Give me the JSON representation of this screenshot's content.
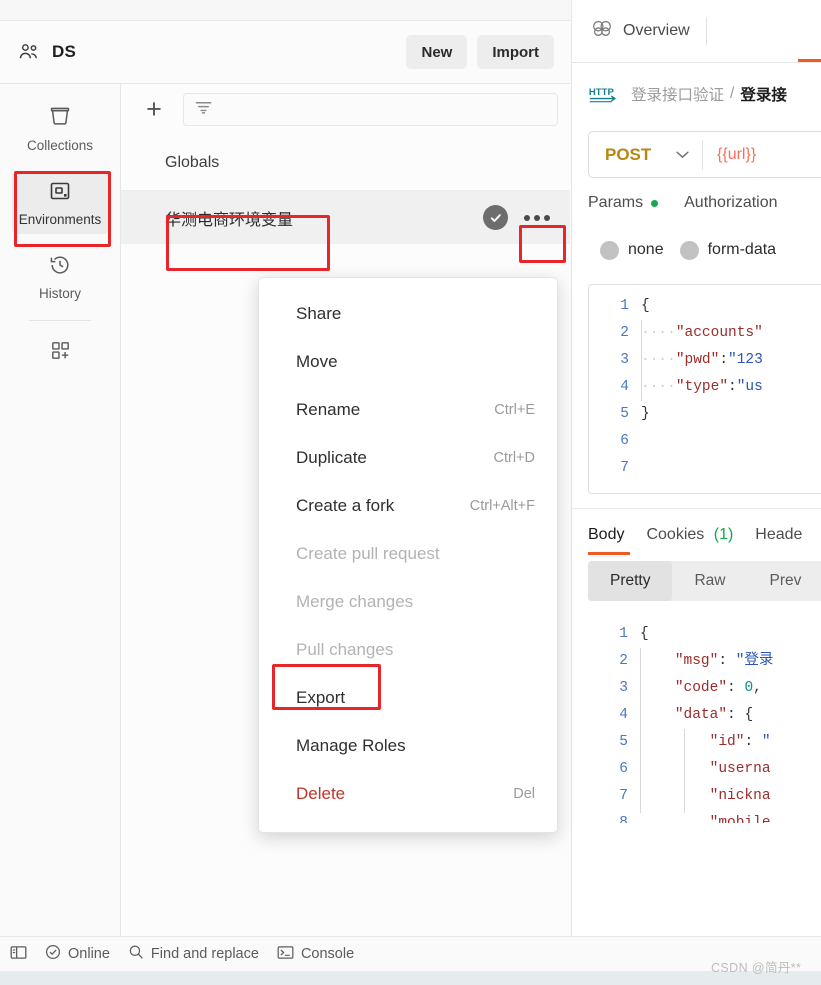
{
  "header": {
    "workspace_icon": "people-icon",
    "workspace_name": "DS",
    "new_label": "New",
    "import_label": "Import"
  },
  "sidebar": {
    "items": [
      {
        "icon": "collections-icon",
        "label": "Collections",
        "active": false
      },
      {
        "icon": "environments-icon",
        "label": "Environments",
        "active": true
      },
      {
        "icon": "history-icon",
        "label": "History",
        "active": false
      },
      {
        "icon": "apps-add-icon",
        "label": "",
        "active": false
      }
    ]
  },
  "environments": {
    "add_button": "+",
    "filter_icon": "filter-icon",
    "filter_placeholder": "",
    "globals_label": "Globals",
    "selected_env": "华测电商环境变量",
    "active_check_icon": "check-circle-icon",
    "more_icon": "more-horizontal-icon"
  },
  "context_menu": {
    "items": [
      {
        "label": "Share",
        "shortcut": "",
        "state": "enabled"
      },
      {
        "label": "Move",
        "shortcut": "",
        "state": "enabled"
      },
      {
        "label": "Rename",
        "shortcut": "Ctrl+E",
        "state": "enabled"
      },
      {
        "label": "Duplicate",
        "shortcut": "Ctrl+D",
        "state": "enabled"
      },
      {
        "label": "Create a fork",
        "shortcut": "Ctrl+Alt+F",
        "state": "enabled"
      },
      {
        "label": "Create pull request",
        "shortcut": "",
        "state": "disabled"
      },
      {
        "label": "Merge changes",
        "shortcut": "",
        "state": "disabled"
      },
      {
        "label": "Pull changes",
        "shortcut": "",
        "state": "disabled"
      },
      {
        "label": "Export",
        "shortcut": "",
        "state": "enabled"
      },
      {
        "label": "Manage Roles",
        "shortcut": "",
        "state": "enabled"
      },
      {
        "label": "Delete",
        "shortcut": "Del",
        "state": "danger"
      }
    ]
  },
  "right_pane": {
    "tabs": {
      "overview_label": "Overview",
      "overview_icon": "overview-rings-icon"
    },
    "breadcrumb": {
      "protocol_badge": "HTTP",
      "parent": "登录接口验证",
      "separator": "/",
      "current": "登录接"
    },
    "request": {
      "method": "POST",
      "method_caret": "chevron-down-icon",
      "url": "{{url}}",
      "tabs": [
        {
          "label": "Params",
          "has_dot": true
        },
        {
          "label": "Authorization",
          "has_dot": false
        }
      ],
      "body_types": [
        {
          "label": "none",
          "selected": false
        },
        {
          "label": "form-data",
          "selected": false
        }
      ],
      "editor": {
        "line_numbers": [
          "1",
          "2",
          "3",
          "4",
          "5",
          "6",
          "7"
        ],
        "lines": [
          [
            {
              "t": "{",
              "c": "p"
            }
          ],
          [
            {
              "t": "····",
              "c": "dots"
            },
            {
              "t": "\"accounts\"",
              "c": "k"
            }
          ],
          [
            {
              "t": "····",
              "c": "dots"
            },
            {
              "t": "\"pwd\"",
              "c": "k"
            },
            {
              "t": ":",
              "c": "p"
            },
            {
              "t": "\"123",
              "c": "s"
            }
          ],
          [
            {
              "t": "····",
              "c": "dots"
            },
            {
              "t": "\"type\"",
              "c": "k"
            },
            {
              "t": ":",
              "c": "p"
            },
            {
              "t": "\"us",
              "c": "s"
            }
          ],
          [
            {
              "t": "}",
              "c": "p"
            }
          ],
          [],
          []
        ]
      }
    },
    "response": {
      "tabs": [
        {
          "label": "Body",
          "active": true,
          "count": ""
        },
        {
          "label": "Cookies",
          "active": false,
          "count": "(1)"
        },
        {
          "label": "Heade",
          "active": false,
          "count": ""
        }
      ],
      "view_modes": [
        {
          "label": "Pretty",
          "active": true
        },
        {
          "label": "Raw",
          "active": false
        },
        {
          "label": "Prev",
          "active": false
        }
      ],
      "editor": {
        "line_numbers": [
          "1",
          "2",
          "3",
          "4",
          "5",
          "6",
          "7",
          "8"
        ],
        "lines": [
          [
            {
              "t": "{",
              "c": "p"
            }
          ],
          [
            {
              "t": "    ",
              "c": "p"
            },
            {
              "t": "\"msg\"",
              "c": "k"
            },
            {
              "t": ": ",
              "c": "p"
            },
            {
              "t": "\"登录",
              "c": "s"
            }
          ],
          [
            {
              "t": "    ",
              "c": "p"
            },
            {
              "t": "\"code\"",
              "c": "k"
            },
            {
              "t": ": ",
              "c": "p"
            },
            {
              "t": "0",
              "c": "n"
            },
            {
              "t": ",",
              "c": "p"
            }
          ],
          [
            {
              "t": "    ",
              "c": "p"
            },
            {
              "t": "\"data\"",
              "c": "k"
            },
            {
              "t": ": ",
              "c": "p"
            },
            {
              "t": "{",
              "c": "p"
            }
          ],
          [
            {
              "t": "        ",
              "c": "p"
            },
            {
              "t": "\"id\"",
              "c": "k"
            },
            {
              "t": ": ",
              "c": "p"
            },
            {
              "t": "\"",
              "c": "s"
            }
          ],
          [
            {
              "t": "        ",
              "c": "p"
            },
            {
              "t": "\"userna",
              "c": "k"
            }
          ],
          [
            {
              "t": "        ",
              "c": "p"
            },
            {
              "t": "\"nickna",
              "c": "k"
            }
          ],
          [
            {
              "t": "        ",
              "c": "p"
            },
            {
              "t": "\"mobile",
              "c": "k"
            }
          ]
        ]
      }
    }
  },
  "statusbar": {
    "items": [
      {
        "icon": "sidebar-toggle-icon",
        "label": ""
      },
      {
        "icon": "check-circle-outline-icon",
        "label": "Online"
      },
      {
        "icon": "search-icon",
        "label": "Find and replace"
      },
      {
        "icon": "terminal-icon",
        "label": "Console"
      }
    ]
  },
  "watermark": {
    "text": "CSDN @简丹**"
  },
  "colors": {
    "highlight_box": "#e8262a",
    "accent_orange": "#ef5b25",
    "method_post": "#b88612",
    "url_variable": "#f4705a",
    "dot_green": "#13a94c",
    "delete_red": "#c0342b"
  }
}
